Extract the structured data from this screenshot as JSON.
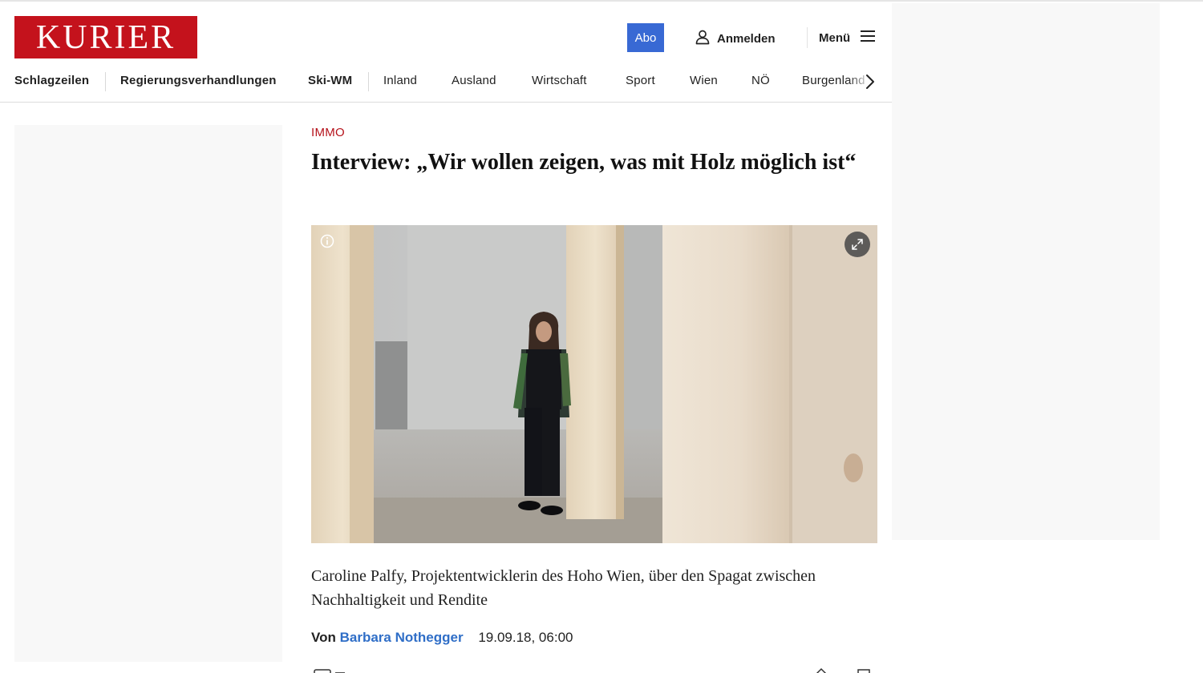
{
  "logo": {
    "text": "KURIER"
  },
  "header": {
    "abo_label": "Abo",
    "login_label": "Anmelden",
    "menu_label": "Menü"
  },
  "nav": {
    "items": [
      {
        "label": "Schlagzeilen",
        "bold": true
      },
      {
        "label": "Regierungsverhandlungen",
        "bold": true
      },
      {
        "label": "Ski-WM",
        "bold": true
      },
      {
        "label": "Inland",
        "bold": false
      },
      {
        "label": "Ausland",
        "bold": false
      },
      {
        "label": "Wirtschaft",
        "bold": false
      },
      {
        "label": "Sport",
        "bold": false
      },
      {
        "label": "Wien",
        "bold": false
      },
      {
        "label": "NÖ",
        "bold": false
      },
      {
        "label": "Burgenland",
        "bold": false
      }
    ]
  },
  "article": {
    "category": "IMMO",
    "headline": "Interview: „Wir wollen zeigen, was mit Holz möglich ist“",
    "lead": "Caroline Palfy, Projektentwicklerin des Hoho Wien, über den Spagat zwischen Nachhaltigkeit und Rendite",
    "byline_prefix": "Von",
    "author": "Barbara Nothegger",
    "date": "19.09.18, 06:00"
  },
  "icons": {
    "user": "user-icon",
    "menu": "hamburger-icon",
    "next": "chevron-right-icon",
    "info": "info-icon",
    "expand": "expand-icon"
  },
  "colors": {
    "brand_red": "#c4121c",
    "category_red": "#b5121b",
    "abo_blue": "#3869d4",
    "author_blue": "#2f6ec7"
  }
}
